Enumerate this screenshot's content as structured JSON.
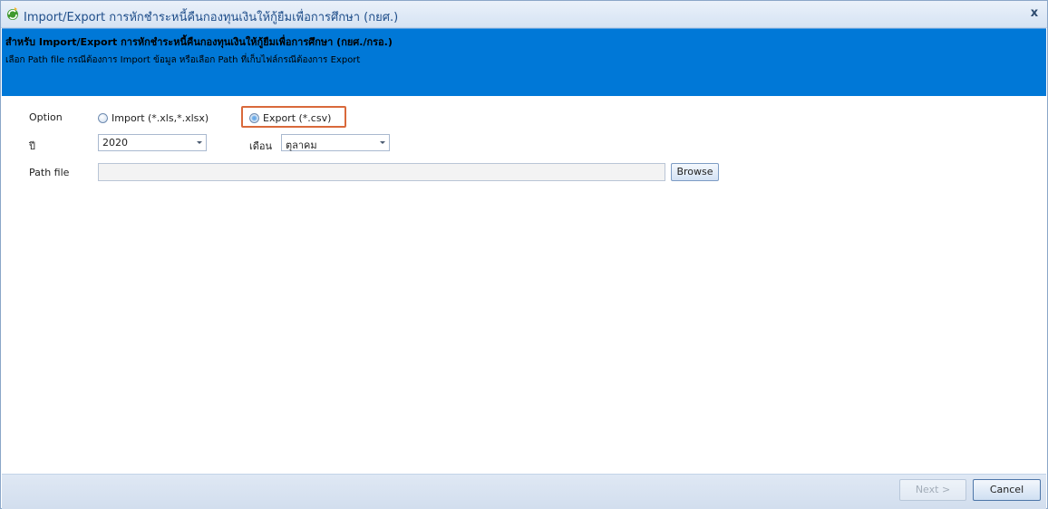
{
  "window": {
    "title": "Import/Export การหักชำระหนี้คืนกองทุนเงินให้กู้ยืมเพื่อการศึกษา (กยศ.)",
    "close_glyph": "x"
  },
  "banner": {
    "title": "สำหรับ Import/Export การหักชำระหนี้คืนกองทุนเงินให้กู้ยืมเพื่อการศึกษา (กยศ./กรอ.)",
    "description": "เลือก Path file กรณีต้องการ Import ข้อมูล หรือเลือก Path ที่เก็บไฟล์กรณีต้องการ Export",
    "background_color": "#0078d7"
  },
  "form": {
    "option_label": "Option",
    "options": [
      {
        "label": "Import (*.xls,*.xlsx)",
        "selected": false
      },
      {
        "label": "Export (*.csv)",
        "selected": true
      }
    ],
    "year_label": "ปี",
    "year_value": "2020",
    "month_label": "เดือน",
    "month_value": "ตุลาคม",
    "path_label": "Path file",
    "path_value": "",
    "browse_label": "Browse"
  },
  "footer": {
    "next_label": "Next >",
    "cancel_label": "Cancel"
  },
  "colors": {
    "highlight_border": "#d9693b",
    "title_text": "#1f4e8a"
  }
}
